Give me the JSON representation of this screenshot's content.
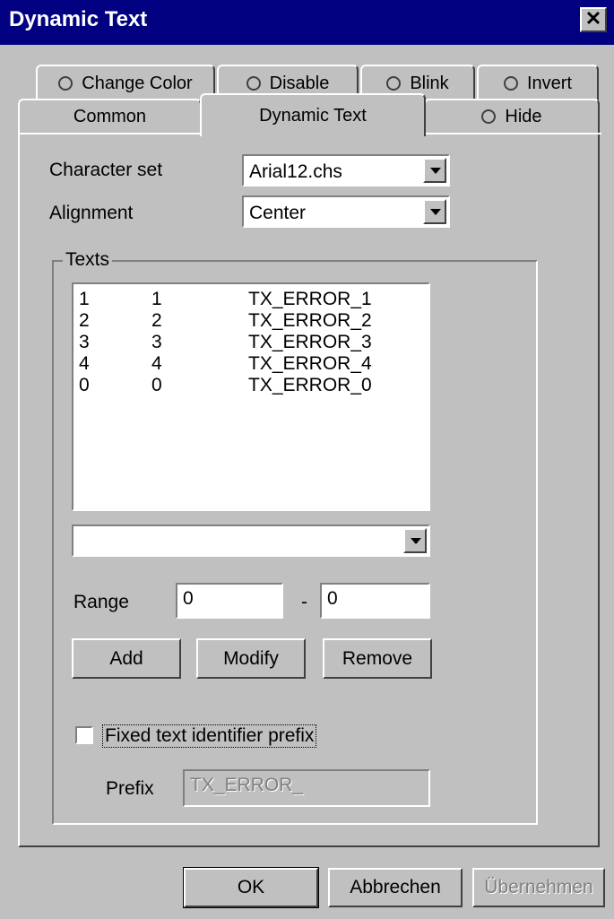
{
  "window": {
    "title": "Dynamic Text"
  },
  "tabs_row1": [
    {
      "label": "Change Color"
    },
    {
      "label": "Disable"
    },
    {
      "label": "Blink"
    },
    {
      "label": "Invert"
    }
  ],
  "tabs_row2": [
    {
      "label": "Common"
    },
    {
      "label": "Dynamic Text",
      "selected": true
    },
    {
      "label": "Hide"
    }
  ],
  "form": {
    "charset_label": "Character set",
    "charset_value": "Arial12.chs",
    "alignment_label": "Alignment",
    "alignment_value": "Center",
    "texts_group_label": "Texts",
    "texts": [
      {
        "from": "1",
        "to": "1",
        "id": "TX_ERROR_1"
      },
      {
        "from": "2",
        "to": "2",
        "id": "TX_ERROR_2"
      },
      {
        "from": "3",
        "to": "3",
        "id": "TX_ERROR_3"
      },
      {
        "from": "4",
        "to": "4",
        "id": "TX_ERROR_4"
      },
      {
        "from": "0",
        "to": "0",
        "id": "TX_ERROR_0"
      }
    ],
    "text_combo_value": "",
    "range_label": "Range",
    "range_from": "0",
    "range_sep": "-",
    "range_to": "0",
    "add_label": "Add",
    "modify_label": "Modify",
    "remove_label": "Remove",
    "fixed_prefix_label": "Fixed text identifier prefix",
    "fixed_prefix_checked": false,
    "prefix_label": "Prefix",
    "prefix_value": "TX_ERROR_"
  },
  "footer": {
    "ok_label": "OK",
    "cancel_label": "Abbrechen",
    "apply_label": "Übernehmen"
  }
}
